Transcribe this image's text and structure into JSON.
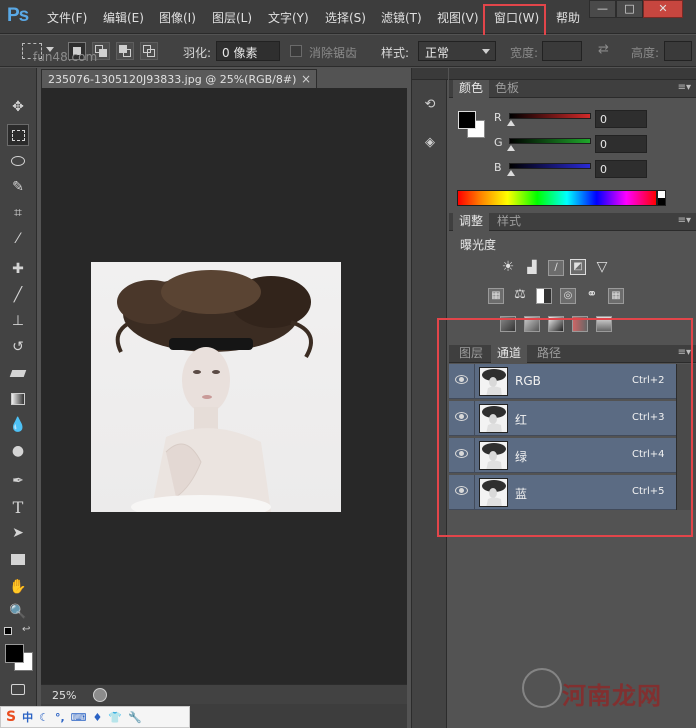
{
  "app": {
    "logo": "Ps"
  },
  "menu": {
    "items": [
      "文件(F)",
      "编辑(E)",
      "图像(I)",
      "图层(L)",
      "文字(Y)",
      "选择(S)",
      "滤镜(T)",
      "视图(V)",
      "窗口(W)",
      "帮助"
    ],
    "highlighted": "窗口(W)"
  },
  "window_controls": {
    "minimize": "—",
    "maximize": "□",
    "close": "✕"
  },
  "options": {
    "feather_label": "羽化:",
    "feather_value": "0 像素",
    "antialias_label": "消除锯齿",
    "style_label": "样式:",
    "style_value": "正常",
    "width_label": "宽度:",
    "height_label": "高度:"
  },
  "document": {
    "tab_title": "235076-1305120J93833.jpg @ 25%(RGB/8#)",
    "tab_close": "×",
    "zoom": "25%"
  },
  "tools": [
    "move-tool-icon",
    "marquee-tool-icon",
    "lasso-tool-icon",
    "quick-select-tool-icon",
    "crop-tool-icon",
    "eyedropper-tool-icon",
    "healing-brush-tool-icon",
    "brush-tool-icon",
    "clone-stamp-tool-icon",
    "history-brush-tool-icon",
    "eraser-tool-icon",
    "gradient-tool-icon",
    "blur-tool-icon",
    "dodge-tool-icon",
    "pen-tool-icon",
    "type-tool-icon",
    "path-select-tool-icon",
    "rectangle-tool-icon",
    "hand-tool-icon",
    "zoom-tool-icon"
  ],
  "type_tool_glyph": "T",
  "color_panel": {
    "tabs": [
      "颜色",
      "色板"
    ],
    "channels": [
      {
        "label": "R",
        "value": "0",
        "color": "#d22a2a"
      },
      {
        "label": "G",
        "value": "0",
        "color": "#1fa82b"
      },
      {
        "label": "B",
        "value": "0",
        "color": "#2a2ad6"
      }
    ],
    "foreground": "#000000",
    "background": "#ffffff"
  },
  "adjust_panel": {
    "tabs": [
      "调整",
      "样式"
    ],
    "title": "曝光度"
  },
  "layers_panel": {
    "tabs": [
      "图层",
      "通道",
      "路径"
    ],
    "active_tab": "通道",
    "channels": [
      {
        "name": "RGB",
        "shortcut": "Ctrl+2"
      },
      {
        "name": "红",
        "shortcut": "Ctrl+3"
      },
      {
        "name": "绿",
        "shortcut": "Ctrl+4"
      },
      {
        "name": "蓝",
        "shortcut": "Ctrl+5"
      }
    ]
  },
  "ime": {
    "s": "S",
    "lang": "中"
  },
  "watermark": {
    "site": "fun48.com",
    "brand": "河南龙网"
  },
  "panel_menu_glyph": "≡▾"
}
